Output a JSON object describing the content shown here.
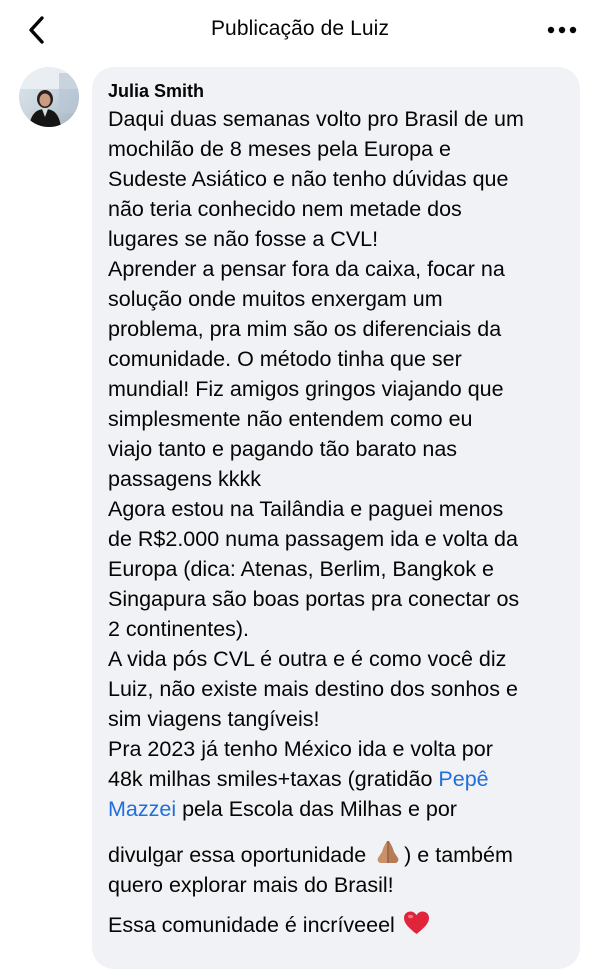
{
  "header": {
    "title": "Publicação de Luiz",
    "back_icon": "chevron-left-icon",
    "more_icon": "more-horizontal-icon"
  },
  "comment": {
    "author": "Julia Smith",
    "lines": [
      "Daqui duas semanas volto pro Brasil de um",
      "mochilão de 8 meses pela Europa e",
      "Sudeste Asiático e não tenho dúvidas que",
      "não teria conhecido nem metade dos",
      "lugares se não fosse a CVL!",
      "Aprender a pensar fora da caixa, focar na",
      "solução onde muitos enxergam um",
      "problema, pra mim são os diferenciais da",
      "comunidade. O método tinha que ser",
      "mundial! Fiz amigos gringos viajando que",
      "simplesmente não entendem como eu",
      "viajo tanto e pagando tão barato nas",
      "passagens kkkk",
      "Agora estou na Tailândia e paguei menos",
      "de R$2.000 numa passagem ida e volta da",
      "Europa (dica: Atenas, Berlim, Bangkok e",
      "Singapura são boas portas pra conectar os",
      "2 continentes).",
      "A vida pós CVL é outra e é como você diz",
      "Luiz, não existe mais destino dos sonhos e",
      "sim viagens tangíveis!",
      "Pra 2023 já tenho México ida e volta por"
    ],
    "line22_pre": "48k milhas smiles+taxas (gratidão ",
    "mention_part1": "Pepê",
    "mention_part2": "Mazzei",
    "line23_post": " pela Escola das Milhas e por",
    "line24_pre": "divulgar essa oportunidade ",
    "line24_post": ") e também",
    "line25": "quero explorar mais do Brasil!",
    "line26": "Essa comunidade é incríveeel ",
    "emoji_pray": "folded-hands-icon",
    "emoji_heart": "red-heart-icon"
  },
  "colors": {
    "bubble": "#f0f2f5",
    "text": "#050505",
    "mention": "#216fdb",
    "heart": "#e0243a"
  }
}
